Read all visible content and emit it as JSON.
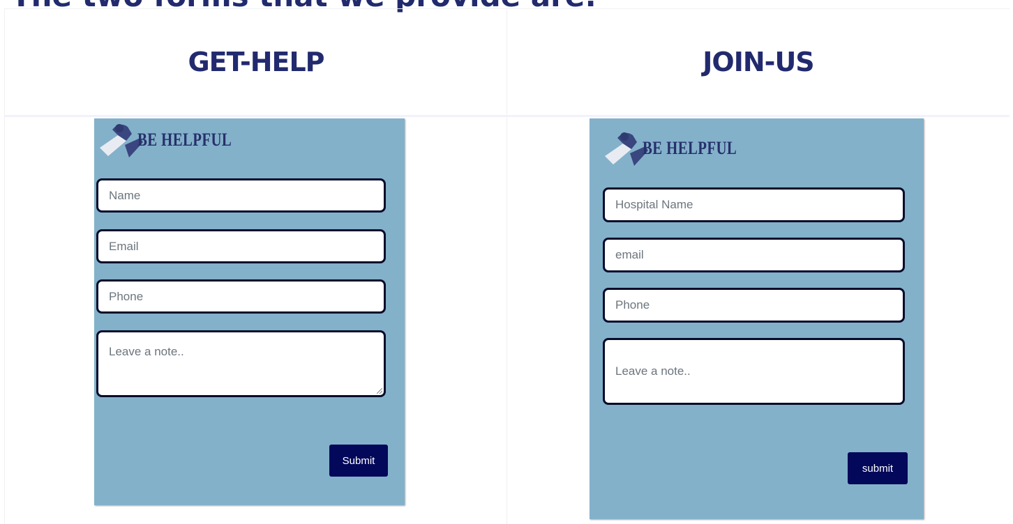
{
  "page": {
    "heading": "The two forms that we provide are:"
  },
  "columns": [
    {
      "title": "GET-HELP"
    },
    {
      "title": "JOIN-US"
    }
  ],
  "brand": {
    "name": "BE HELPFUL"
  },
  "get_help_form": {
    "name_placeholder": "Name",
    "email_placeholder": "Email",
    "phone_placeholder": "Phone",
    "note_placeholder": "Leave a note..",
    "submit_label": "Submit"
  },
  "join_us_form": {
    "hospital_placeholder": "Hospital Name",
    "email_placeholder": "email",
    "phone_placeholder": "Phone",
    "note_placeholder": "Leave a note..",
    "submit_label": "submit"
  },
  "colors": {
    "heading": "#222a6e",
    "card_background": "#83b1ca",
    "field_border": "#060b2a",
    "button": "#04085a"
  },
  "icons": [
    "handshake-logo-icon"
  ]
}
